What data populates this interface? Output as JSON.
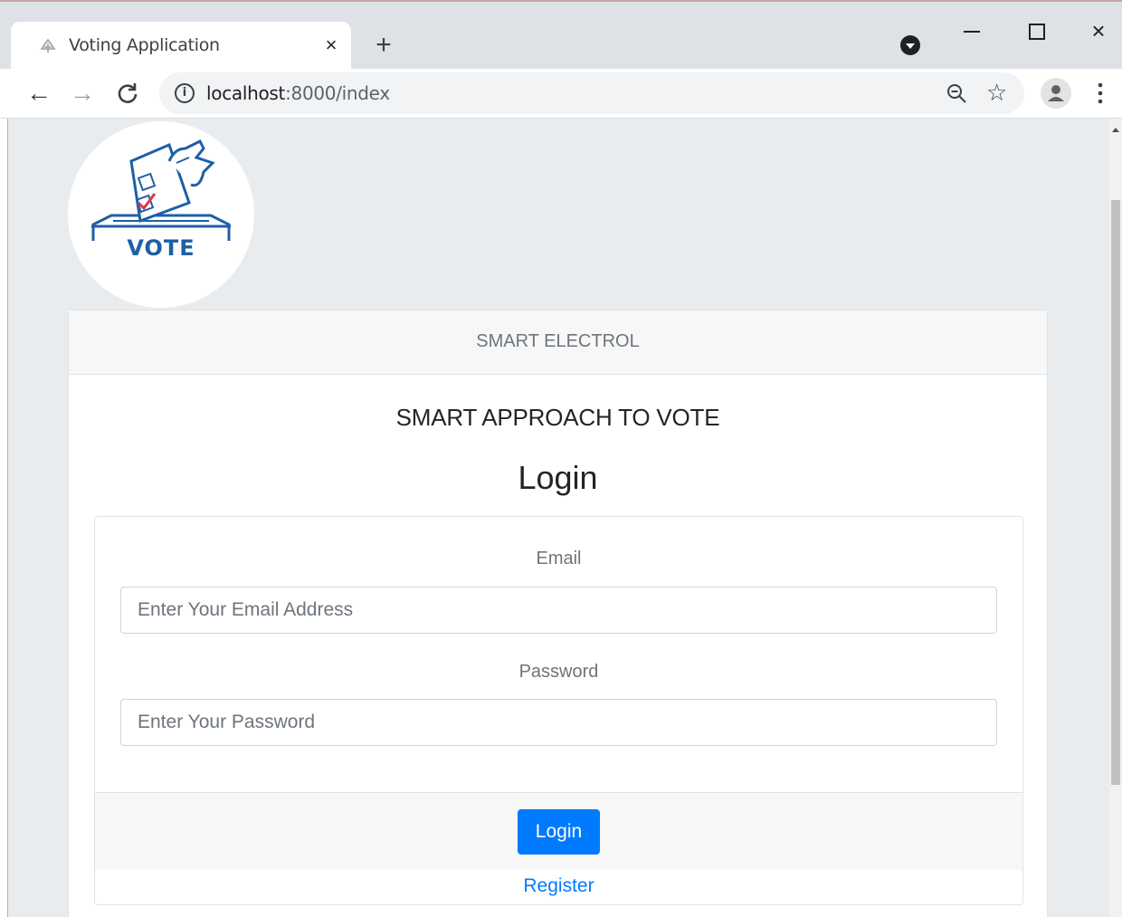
{
  "browser": {
    "tab_title": "Voting Application",
    "tab_close": "×",
    "new_tab": "+",
    "url_host": "localhost",
    "url_path": ":8000/index",
    "info_glyph": "i",
    "window_close": "×"
  },
  "logo": {
    "text": "VOTE",
    "color": "#1e5fa6",
    "check_color": "#d63a4f"
  },
  "card": {
    "header": "SMART ELECTROL",
    "subtitle": "SMART APPROACH TO VOTE",
    "heading": "Login"
  },
  "form": {
    "email_label": "Email",
    "email_placeholder": "Enter Your Email Address",
    "password_label": "Password",
    "password_placeholder": "Enter Your Password",
    "login_label": "Login",
    "register_label": "Register"
  },
  "colors": {
    "primary": "#007bff",
    "page_background": "#e9ecef"
  }
}
